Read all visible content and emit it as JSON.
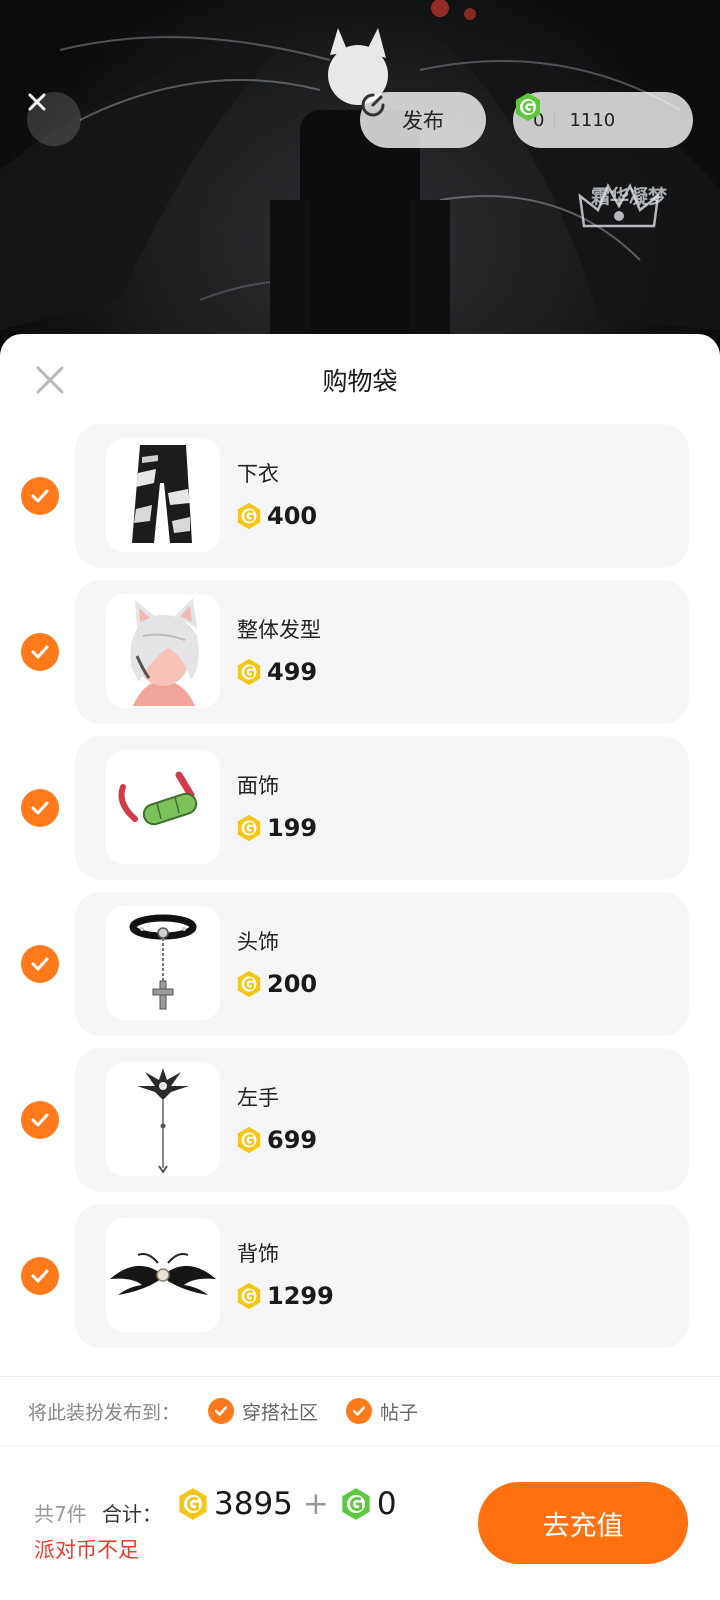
{
  "topbar": {
    "publish_label": "发布",
    "party_coin_balance": "0",
    "gcoin_balance": "1110"
  },
  "watermark": {
    "text": "霜华凝梦"
  },
  "sheet": {
    "title": "购物袋",
    "items": [
      {
        "name": "下衣",
        "price": "400",
        "checked": true,
        "icon": "pants"
      },
      {
        "name": "整体发型",
        "price": "499",
        "checked": true,
        "icon": "hair"
      },
      {
        "name": "面饰",
        "price": "199",
        "checked": true,
        "icon": "mask"
      },
      {
        "name": "头饰",
        "price": "200",
        "checked": true,
        "icon": "choker"
      },
      {
        "name": "左手",
        "price": "699",
        "checked": true,
        "icon": "staff"
      },
      {
        "name": "背饰",
        "price": "1299",
        "checked": true,
        "icon": "wings"
      }
    ],
    "publish_to_label": "将此装扮发布到：",
    "publish_options": [
      {
        "label": "穿搭社区",
        "checked": true
      },
      {
        "label": "帖子",
        "checked": true
      }
    ]
  },
  "footer": {
    "count_label": "共7件",
    "sum_label": "合计：",
    "total_party_coins": "3895",
    "total_gcoins": "0",
    "warning": "派对币不足",
    "recharge_label": "去充值"
  },
  "colors": {
    "accent": "#ff7a1a",
    "gold_coin": "#f5c518",
    "green_coin": "#5cc83c",
    "warning": "#ef3b2c"
  }
}
